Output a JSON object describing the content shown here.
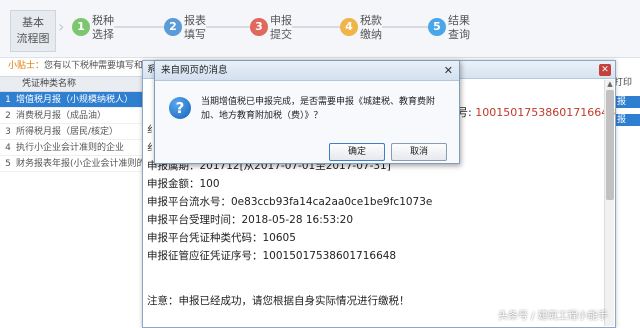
{
  "workflow": {
    "basic_label_1": "基本",
    "basic_label_2": "流程图",
    "steps": [
      {
        "num": "1",
        "line1": "税种",
        "line2": "选择",
        "color": "#7cc66f"
      },
      {
        "num": "2",
        "line1": "报表",
        "line2": "填写",
        "color": "#5b9bd8"
      },
      {
        "num": "3",
        "line1": "申报",
        "line2": "提交",
        "color": "#e0685c"
      },
      {
        "num": "4",
        "line1": "税款",
        "line2": "缴纳",
        "color": "#f0b54a"
      },
      {
        "num": "5",
        "line1": "结果",
        "line2": "查询",
        "color": "#4aa6e6"
      }
    ]
  },
  "hint": {
    "prefix": "小贴士：",
    "text": "您有以下税种需要填写和申"
  },
  "table": {
    "header": "凭证种类名称",
    "rows": [
      {
        "num": "1",
        "name": "增值税月报（小规模纳税人）",
        "selected": true
      },
      {
        "num": "2",
        "name": "消费税月报（成品油）",
        "selected": false
      },
      {
        "num": "3",
        "name": "所得税月报（居民/核定）",
        "selected": false
      },
      {
        "num": "4",
        "name": "执行小企业会计准则的企业",
        "selected": false
      },
      {
        "num": "5",
        "name": "财务报表年报(小企业会计准则的企",
        "selected": false
      }
    ]
  },
  "right": {
    "header": "打印",
    "button": "报"
  },
  "system_window": {
    "title": "系",
    "snippet_1": "纟",
    "snippet_2": "纟",
    "cert_label": "证序号:",
    "cert_value": "10015017538601716648",
    "lines": [
      "申报属期：201712[从2017-07-01至2017-07-31]",
      "申报金额：100",
      "申报平台流水号：0e83ccb93fa14ca2aa0ce1be9fc1073e",
      "申报平台受理时间：2018-05-28 16:53:20",
      "申报平台凭证种类代码：10605",
      "申报征管应征凭证序号：10015017538601716648"
    ],
    "note": "注意：申报已经成功，请您根据自身实际情况进行缴税！"
  },
  "dialog": {
    "title": "来自网页的消息",
    "message": "当期增值税已申报完成，是否需要申报《城建税、教育费附加、地方教育附加税（费）》？",
    "ok": "确定",
    "cancel": "取消"
  },
  "watermark": "头条号 / 建筑工程小能手"
}
